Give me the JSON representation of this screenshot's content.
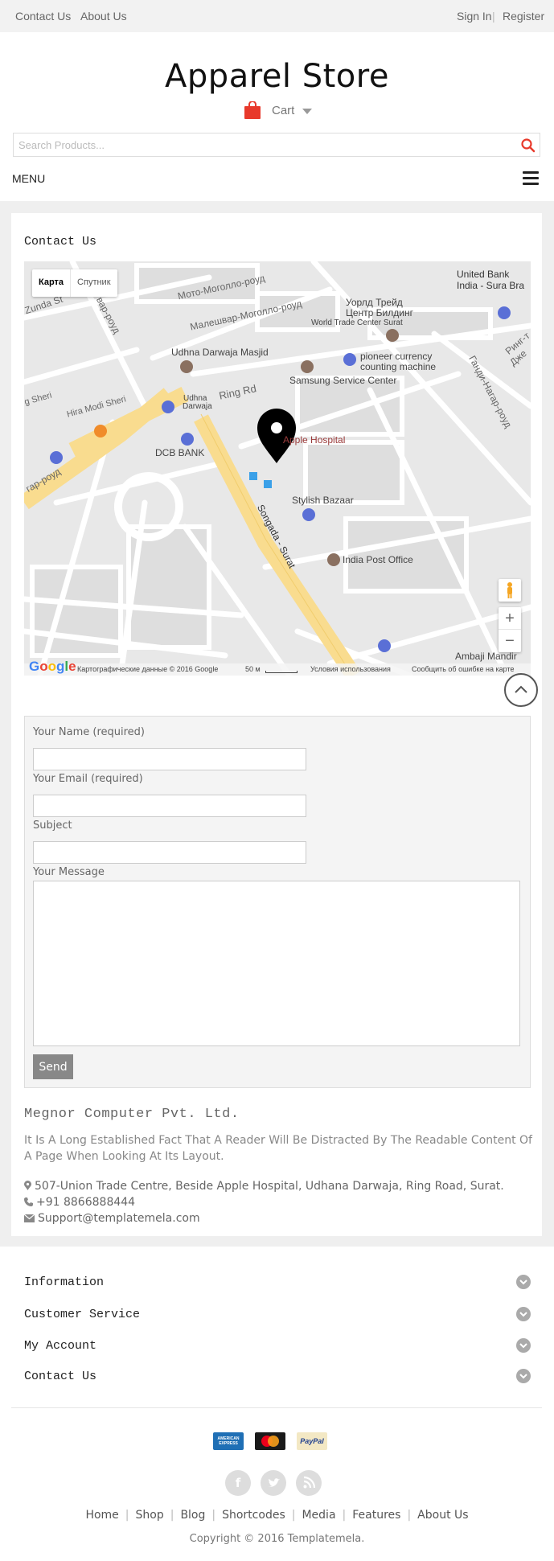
{
  "topbar": {
    "left_links": [
      "Contact Us",
      "About Us"
    ],
    "sign_in": "Sign In",
    "separator": "|",
    "register": "Register"
  },
  "header": {
    "logo": "Apparel Store",
    "cart_label": "Cart",
    "search_placeholder": "Search Products...",
    "menu_label": "MENU"
  },
  "page": {
    "title": "Contact Us"
  },
  "map": {
    "type_buttons": [
      "Карта",
      "Спутник"
    ],
    "labels": {
      "united_bank": "United Bank",
      "india_sbr": "India - Sura Bra",
      "moto_mogollo": "Мото-Моголло-роуд",
      "zunda": "Zunda St",
      "vad_road": "вар-роуд",
      "malheshvar": "Малешвар-Моголло-роуд",
      "world_trade_ru1": "Уорлд Трейд",
      "world_trade_ru2": "Центр Билдинг",
      "world_trade_en": "World Trade Center Surat",
      "ring_ru": "Ринг-т",
      "dzhe": "Дже",
      "udhna_masjid": "Udhna Darwaja Masjid",
      "pioneer1": "pioneer currency",
      "pioneer2": "counting machine",
      "samsung": "Samsung Service Center",
      "ring_rd": "Ring Rd",
      "hira_modi": "Hira Modi Sheri",
      "sheri": "g Sheri",
      "udhna_darwaja1": "Udhna",
      "udhna_darwaja2": "Darwaja",
      "apple_hospital": "Apple Hospital",
      "dcb": "DCB BANK",
      "gandhi_nagar": "Ганди-Нагар-роуд",
      "gar_road": "гар-роуд",
      "stylish_bazaar": "Stylish Bazaar",
      "songada": "Songada - Surat",
      "india_post": "India Post Office",
      "ambaji": "Ambaji Mandir"
    },
    "footer": {
      "attribution": "Картографические данные © 2016 Google",
      "scale": "50 м",
      "terms": "Условия использования",
      "report": "Сообщить об ошибке на карте"
    },
    "google_logo": "Google"
  },
  "form": {
    "name_label": "Your Name (required)",
    "email_label": "Your Email (required)",
    "subject_label": "Subject",
    "message_label": "Your Message",
    "send_label": "Send"
  },
  "company": {
    "name": "Megnor Computer Pvt. Ltd.",
    "description": "It Is A Long Established Fact That A Reader Will Be Distracted By The Readable Content Of A Page When Looking At Its Layout.",
    "address": "507-Union Trade Centre, Beside Apple Hospital, Udhana Darwaja, Ring Road, Surat.",
    "phone": "+91 8866888444",
    "email": "Support@templatemela.com"
  },
  "footer": {
    "sections": [
      "Information",
      "Customer Service",
      "My Account",
      "Contact Us"
    ],
    "payments": [
      "AMERICAN EXPRESS",
      "MasterCard",
      "PayPal"
    ],
    "social": [
      "f",
      "t",
      "rss"
    ],
    "links": [
      "Home",
      "Shop",
      "Blog",
      "Shortcodes",
      "Media",
      "Features",
      "About Us"
    ],
    "link_separator": "|",
    "copyright": "Copyright © 2016 Templatemela."
  },
  "colors": {
    "cart_red": "#e8392b",
    "search_red": "#e8392b",
    "road_yellow": "#f9dc8f",
    "map_bg": "#e8e8e8",
    "send_button": "#888888",
    "pin": "#000000"
  }
}
